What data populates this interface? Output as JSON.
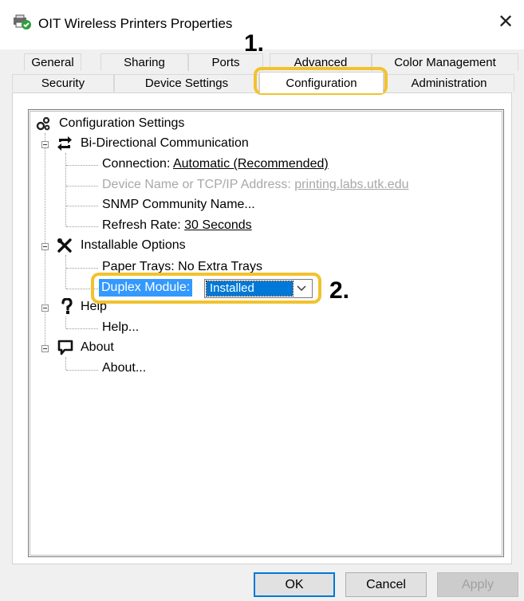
{
  "window": {
    "title": "OIT Wireless Printers Properties",
    "close_glyph": "✕"
  },
  "tabs_row1": [
    {
      "label": "General"
    },
    {
      "label": "Sharing"
    },
    {
      "label": "Ports"
    },
    {
      "label": "Advanced"
    },
    {
      "label": "Color Management"
    }
  ],
  "tabs_row2": [
    {
      "label": "Security"
    },
    {
      "label": "Device Settings"
    },
    {
      "label": "Configuration",
      "active": true
    },
    {
      "label": "Administration"
    }
  ],
  "tree": {
    "root": "Configuration Settings",
    "bidi": {
      "label": "Bi-Directional Communication",
      "connection_label": "Connection: ",
      "connection_value": "Automatic (Recommended)",
      "device_label": "Device Name or TCP/IP Address: ",
      "device_value": "printing.labs.utk.edu",
      "snmp": "SNMP Community Name...",
      "refresh_label": "Refresh Rate: ",
      "refresh_value": "30 Seconds"
    },
    "options": {
      "label": "Installable Options",
      "paper_trays": "Paper Trays: No Extra Trays",
      "duplex_label": "Duplex Module:",
      "duplex_value": "Installed"
    },
    "help": {
      "label": "Help",
      "item": "Help..."
    },
    "about": {
      "label": "About",
      "item": "About..."
    }
  },
  "annotations": {
    "step1": "1.",
    "step2": "2.",
    "highlight_color": "#f2c22e"
  },
  "buttons": {
    "ok": "OK",
    "cancel": "Cancel",
    "apply": "Apply"
  },
  "icons": {
    "app": "printer-icon",
    "root": "gears-icon",
    "bidi": "arrows-exchange-icon",
    "options": "tools-icon",
    "help": "question-icon",
    "about": "speech-bubble-icon"
  }
}
